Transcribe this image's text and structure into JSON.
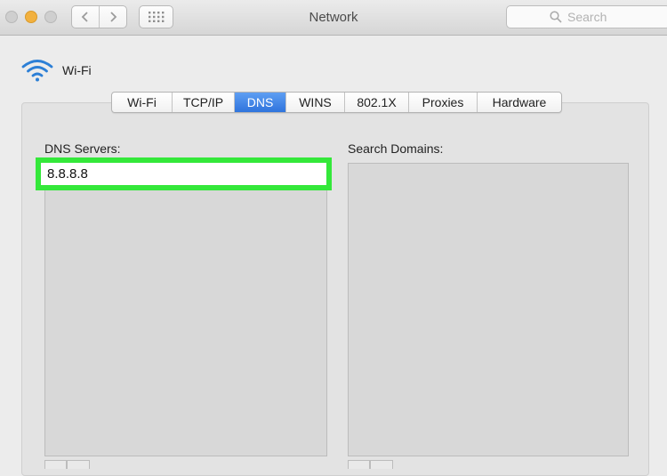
{
  "window": {
    "title": "Network"
  },
  "toolbar": {
    "back_icon": "chevron-left-icon",
    "forward_icon": "chevron-right-icon",
    "show_all_icon": "grid-icon",
    "search_placeholder": "Search"
  },
  "interface": {
    "icon": "wifi-icon",
    "name": "Wi-Fi"
  },
  "tabs": [
    {
      "label": "Wi-Fi",
      "active": false
    },
    {
      "label": "TCP/IP",
      "active": false
    },
    {
      "label": "DNS",
      "active": true
    },
    {
      "label": "WINS",
      "active": false
    },
    {
      "label": "802.1X",
      "active": false
    },
    {
      "label": "Proxies",
      "active": false
    },
    {
      "label": "Hardware",
      "active": false
    }
  ],
  "dns": {
    "servers_label": "DNS Servers:",
    "servers": [
      "8.8.8.8"
    ],
    "search_domains_label": "Search Domains:",
    "search_domains": []
  },
  "colors": {
    "highlight": "#34e83a",
    "active_tab": "#2f74dd",
    "minimize": "#f2b13f"
  }
}
